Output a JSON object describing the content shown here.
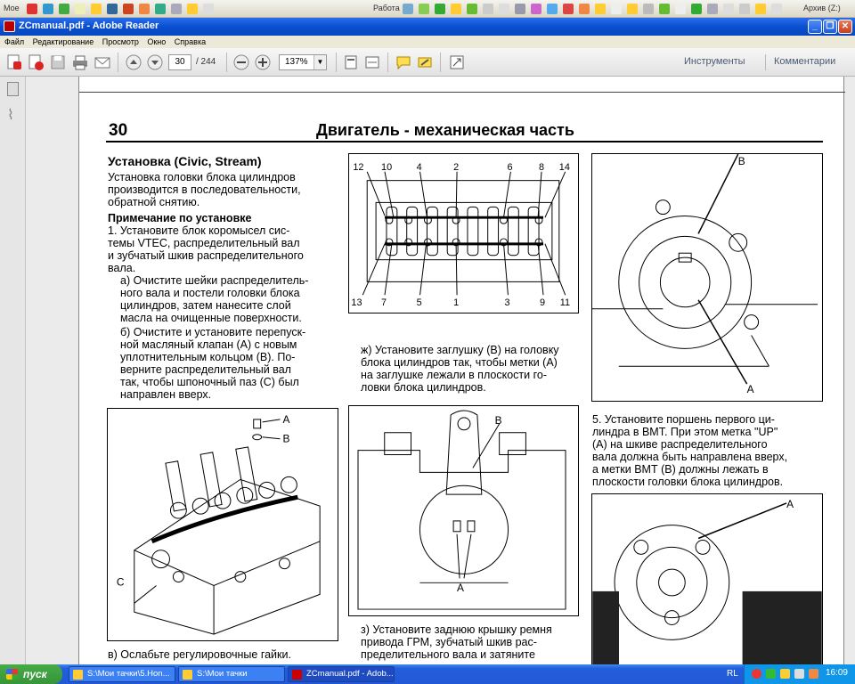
{
  "quicklaunch": {
    "left_label": "Мое",
    "middle_label": "Работа",
    "right_label": "Архив (Z:)"
  },
  "window": {
    "title": "ZCmanual.pdf - Adobe Reader"
  },
  "menu": [
    "Файл",
    "Редактирование",
    "Просмотр",
    "Окно",
    "Справка"
  ],
  "toolbar": {
    "current_page": "30",
    "page_total": "/ 244",
    "zoom": "137%",
    "tools_label": "Инструменты",
    "comments_label": "Комментарии"
  },
  "document": {
    "page_number": "30",
    "page_title": "Двигатель - механическая часть",
    "section_title": "Установка (Civic, Stream)",
    "intro": [
      "Установка головки блока цилиндров",
      "производится в последовательности,",
      "обратной снятию."
    ],
    "note_title": "Примечание по установке",
    "step1": [
      "1. Установите блок коромысел сис-",
      "темы VTEC, распределительный вал",
      "и зубчатый шкив распределительного",
      "вала."
    ],
    "step1a": [
      "а) Очистите шейки распределитель-",
      "ного вала и постели головки блока",
      "цилиндров, затем нанесите слой",
      "масла на очищенные поверхности."
    ],
    "step1b": [
      "б) Очистите и установите перепуск-",
      "ной масляный клапан (А) с новым",
      "уплотнительным кольцом (В). По-",
      "верните распределительный вал",
      "так, чтобы шпоночный паз (С) был",
      "направлен вверх."
    ],
    "caption_v": "в) Ослабьте регулировочные гайки.",
    "caption_zh": [
      "ж) Установите заглушку (В) на головку",
      "блока цилиндров так, чтобы метки (А)",
      "на заглушке лежали в плоскости го-",
      "ловки блока цилиндров."
    ],
    "caption_z": [
      "з) Установите заднюю крышку ремня",
      "привода ГРМ, зубчатый шкив рас-",
      "пределительного вала и затяните"
    ],
    "step5": [
      "5. Установите поршень первого ци-",
      "линдра в ВМТ. При этом метка \"UP\"",
      "(А) на шкиве распределительного",
      "вала должна быть направлена вверх,",
      "а метки ВМТ (В) должны лежать в",
      "плоскости головки блока цилиндров."
    ],
    "figure_head": {
      "top_numbers": [
        "12",
        "10",
        "4",
        "2",
        "6",
        "8",
        "14"
      ],
      "bottom_numbers": [
        "13",
        "7",
        "5",
        "1",
        "3",
        "9",
        "11"
      ]
    },
    "figure_pulley": {
      "label_b": "B",
      "label_a": "A"
    },
    "figure_valve": {
      "label_a": "A",
      "label_b": "B",
      "label_c": "C"
    },
    "figure_cap": {
      "label_b": "B",
      "label_a": "A"
    },
    "figure_pulley2": {
      "label_a": "A"
    }
  },
  "taskbar": {
    "start_label": "пуск",
    "tasks": [
      "S:\\Мои тачки\\5.Hon...",
      "S:\\Мои тачки",
      "ZCmanual.pdf - Adob..."
    ],
    "language": "RL",
    "clock": "16:09"
  }
}
